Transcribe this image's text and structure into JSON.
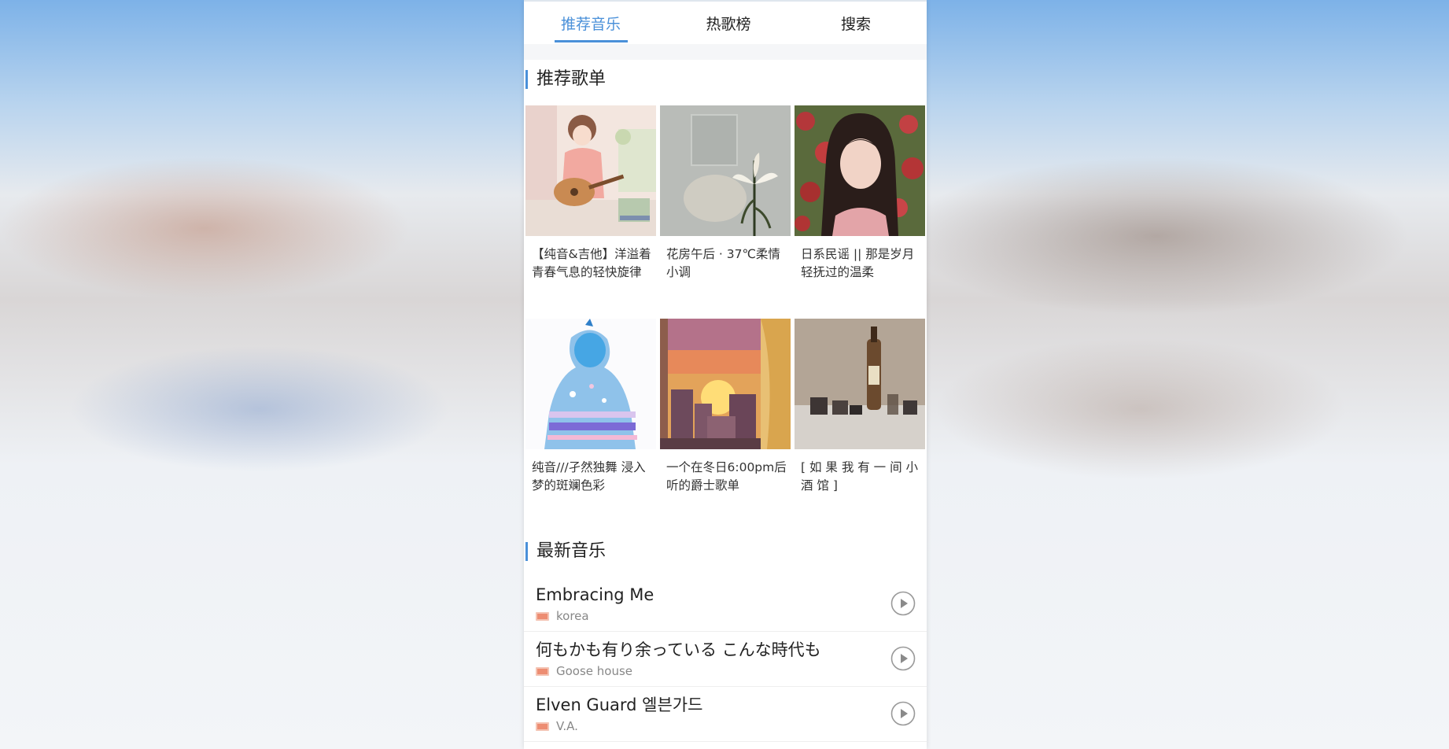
{
  "colors": {
    "accent": "#4a90d9",
    "text": "#222222",
    "subtext": "#888888",
    "sq_badge": "#e8603c"
  },
  "tabs": [
    {
      "label": "推荐音乐",
      "active": true
    },
    {
      "label": "热歌榜",
      "active": false
    },
    {
      "label": "搜索",
      "active": false
    }
  ],
  "recommended": {
    "title": "推荐歌单",
    "playlists": [
      {
        "title": "【纯音&吉他】洋溢着青春气息的轻快旋律",
        "cover": "girl-with-guitar-illustration"
      },
      {
        "title": "花房午后 · 37℃柔情小调",
        "cover": "lily-on-grey-wall"
      },
      {
        "title": "日系民谣 || 那是岁月轻抚过的温柔",
        "cover": "girl-with-red-flowers-photo"
      },
      {
        "title": "纯音///孑然独舞 浸入梦的斑斓色彩",
        "cover": "blue-silhouette-illustration"
      },
      {
        "title": "一个在冬日6:00pm后听的爵士歌单",
        "cover": "sunset-window-pixel-art"
      },
      {
        "title": "[ 如 果 我 有 一 间 小 酒 馆 ]",
        "cover": "bottles-on-table-still-life"
      }
    ]
  },
  "latest": {
    "title": "最新音乐",
    "songs": [
      {
        "title": "Embracing Me",
        "artist": "korea",
        "icon": "play-circle-icon"
      },
      {
        "title": "何もかも有り余っている こんな時代も",
        "artist": "Goose house",
        "icon": "play-circle-icon"
      },
      {
        "title": "Elven Guard 엘븐가드",
        "artist": "V.A.",
        "icon": "play-circle-icon"
      }
    ]
  }
}
